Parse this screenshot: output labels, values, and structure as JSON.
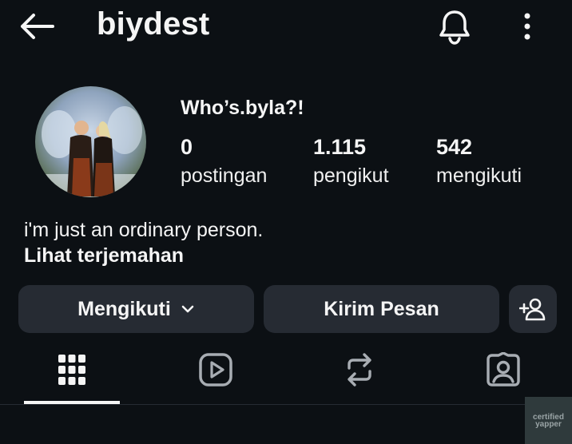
{
  "header": {
    "username": "biydest",
    "back_icon": "arrow-left-icon",
    "notification_icon": "bell-icon",
    "more_icon": "more-vertical-icon"
  },
  "profile": {
    "display_name": "Who’s.byla?!",
    "stats": [
      {
        "count": "0",
        "label": "postingan"
      },
      {
        "count": "1.115",
        "label": "pengikut"
      },
      {
        "count": "542",
        "label": "mengikuti"
      }
    ],
    "bio": "i'm just an ordinary person.",
    "translate_link": "Lihat terjemahan"
  },
  "actions": {
    "following_label": "Mengikuti",
    "message_label": "Kirim Pesan",
    "add_user_icon": "person-add-icon"
  },
  "tabs": [
    {
      "icon": "grid-icon",
      "active": true
    },
    {
      "icon": "reels-icon",
      "active": false
    },
    {
      "icon": "repost-icon",
      "active": false
    },
    {
      "icon": "tagged-icon",
      "active": false
    }
  ],
  "watermark": {
    "line1": "certified",
    "line2": "yapper"
  },
  "colors": {
    "background": "#0c1014",
    "button": "#262b33",
    "text": "#f5f5f5"
  }
}
